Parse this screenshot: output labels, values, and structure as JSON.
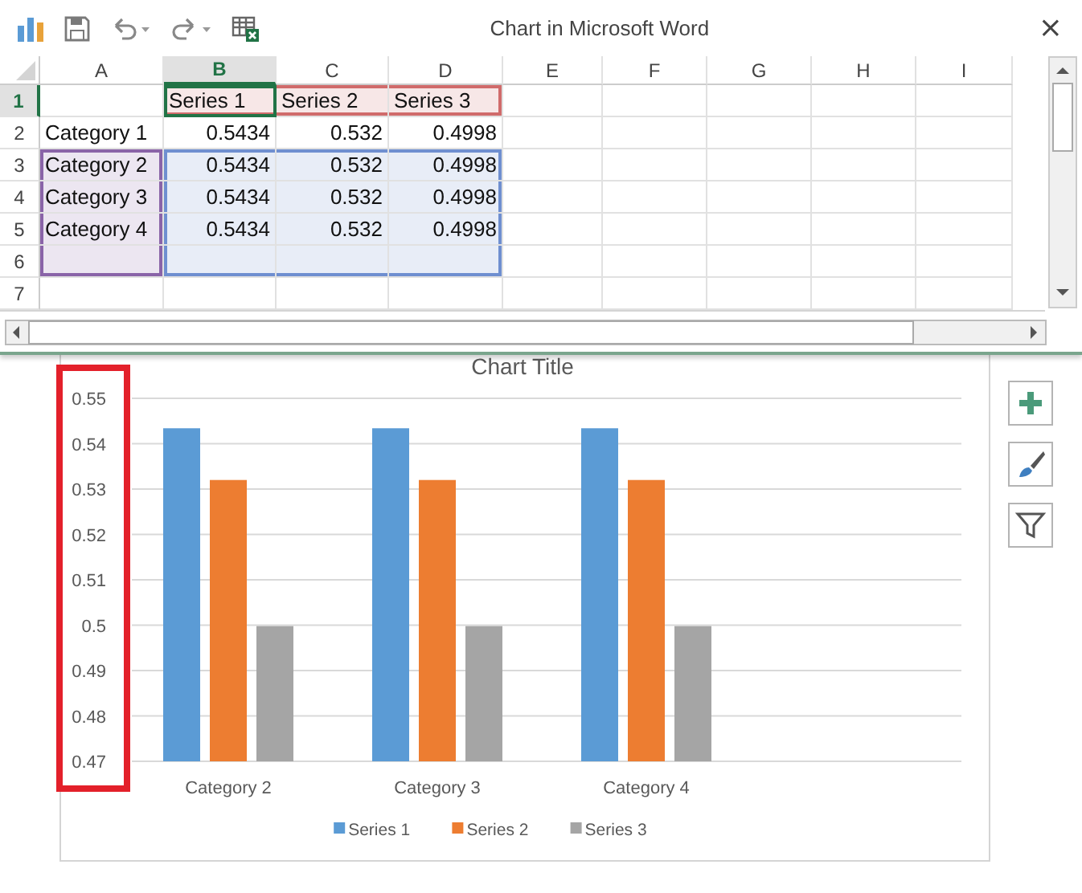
{
  "window": {
    "title": "Chart in Microsoft Word",
    "close": "×"
  },
  "sheet": {
    "columns": [
      {
        "label": "A",
        "selected": false
      },
      {
        "label": "B",
        "selected": true
      },
      {
        "label": "C",
        "selected": false
      },
      {
        "label": "D",
        "selected": false
      },
      {
        "label": "E",
        "selected": false
      },
      {
        "label": "F",
        "selected": false
      },
      {
        "label": "G",
        "selected": false
      },
      {
        "label": "H",
        "selected": false
      },
      {
        "label": "I",
        "selected": false
      }
    ],
    "rows": [
      {
        "header": "1",
        "selected": true,
        "cells": [
          {
            "selected": false
          },
          {
            "text": "Series 1",
            "kind": "series",
            "selected": true
          },
          {
            "text": "Series 2",
            "kind": "series",
            "selected": false
          },
          {
            "text": "Series 3",
            "kind": "series",
            "selected": false
          },
          {
            "selected": false
          },
          {
            "selected": false
          },
          {
            "selected": false
          },
          {
            "selected": false
          },
          {
            "selected": false
          }
        ]
      },
      {
        "header": "2",
        "selected": false,
        "cells": [
          {
            "text": "Category 1",
            "kind": "text",
            "selected": false
          },
          {
            "text": "0.5434",
            "kind": "number",
            "selected": false
          },
          {
            "text": "0.532",
            "kind": "number",
            "selected": false
          },
          {
            "text": "0.4998",
            "kind": "number",
            "selected": false
          },
          {
            "selected": false
          },
          {
            "selected": false
          },
          {
            "selected": false
          },
          {
            "selected": false
          },
          {
            "selected": false
          }
        ]
      },
      {
        "header": "3",
        "selected": false,
        "cells": [
          {
            "text": "Category 2",
            "kind": "category",
            "selected": false
          },
          {
            "text": "0.5434",
            "kind": "value",
            "selected": false
          },
          {
            "text": "0.532",
            "kind": "value",
            "selected": false
          },
          {
            "text": "0.4998",
            "kind": "value",
            "selected": false
          },
          {
            "selected": false
          },
          {
            "selected": false
          },
          {
            "selected": false
          },
          {
            "selected": false
          },
          {
            "selected": false
          }
        ]
      },
      {
        "header": "4",
        "selected": false,
        "cells": [
          {
            "text": "Category 3",
            "kind": "category",
            "selected": false
          },
          {
            "text": "0.5434",
            "kind": "value",
            "selected": false
          },
          {
            "text": "0.532",
            "kind": "value",
            "selected": false
          },
          {
            "text": "0.4998",
            "kind": "value",
            "selected": false
          },
          {
            "selected": false
          },
          {
            "selected": false
          },
          {
            "selected": false
          },
          {
            "selected": false
          },
          {
            "selected": false
          }
        ]
      },
      {
        "header": "5",
        "selected": false,
        "cells": [
          {
            "text": "Category 4",
            "kind": "category",
            "selected": false
          },
          {
            "text": "0.5434",
            "kind": "value",
            "selected": false
          },
          {
            "text": "0.532",
            "kind": "value",
            "selected": false
          },
          {
            "text": "0.4998",
            "kind": "value",
            "selected": false
          },
          {
            "selected": false
          },
          {
            "selected": false
          },
          {
            "selected": false
          },
          {
            "selected": false
          },
          {
            "selected": false
          }
        ]
      },
      {
        "header": "6",
        "selected": false,
        "cells": [
          {
            "kind": "category",
            "selected": false
          },
          {
            "kind": "value",
            "selected": false
          },
          {
            "kind": "value",
            "selected": false
          },
          {
            "kind": "value",
            "selected": false
          },
          {
            "selected": false
          },
          {
            "selected": false
          },
          {
            "selected": false
          },
          {
            "selected": false
          },
          {
            "selected": false
          }
        ]
      },
      {
        "header": "7",
        "selected": false,
        "cells": [
          {
            "selected": false
          },
          {
            "selected": false
          },
          {
            "selected": false
          },
          {
            "selected": false
          },
          {
            "selected": false
          },
          {
            "selected": false
          },
          {
            "selected": false
          },
          {
            "selected": false
          },
          {
            "selected": false
          }
        ]
      }
    ]
  },
  "chart": {
    "chart_data": {
      "type": "bar",
      "title": "Chart Title",
      "categories": [
        "Category 2",
        "Category 3",
        "Category 4"
      ],
      "series": [
        {
          "name": "Series 1",
          "color": "#5b9bd5",
          "values": [
            0.5434,
            0.5434,
            0.5434
          ]
        },
        {
          "name": "Series 2",
          "color": "#ed7d31",
          "values": [
            0.532,
            0.532,
            0.532
          ]
        },
        {
          "name": "Series 3",
          "color": "#a5a5a5",
          "values": [
            0.4998,
            0.4998,
            0.4998
          ]
        }
      ],
      "ylim": [
        0.47,
        0.55
      ],
      "yticks": [
        0.47,
        0.48,
        0.49,
        {
          "value": 0.5,
          "label": "0.5"
        },
        0.51,
        0.52,
        0.53,
        0.54,
        0.55
      ],
      "grid": true,
      "legend": "bottom"
    },
    "axis_highlight": {
      "color": "#e3202a"
    }
  },
  "chart_tools": [
    {
      "kind": "add"
    },
    {
      "kind": "style"
    },
    {
      "kind": "filter"
    }
  ]
}
